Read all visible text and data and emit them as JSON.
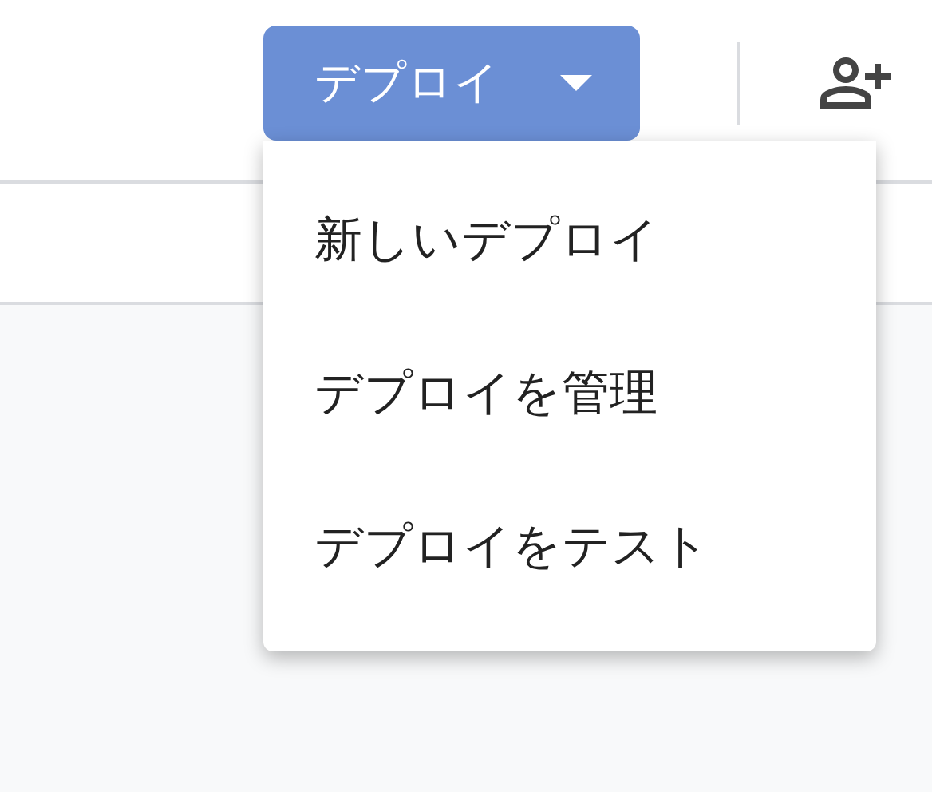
{
  "deploy_button": {
    "label": "デプロイ",
    "expanded": true
  },
  "menu": {
    "items": [
      {
        "label": "新しいデプロイ"
      },
      {
        "label": "デプロイを管理"
      },
      {
        "label": "デプロイをテスト"
      }
    ]
  }
}
